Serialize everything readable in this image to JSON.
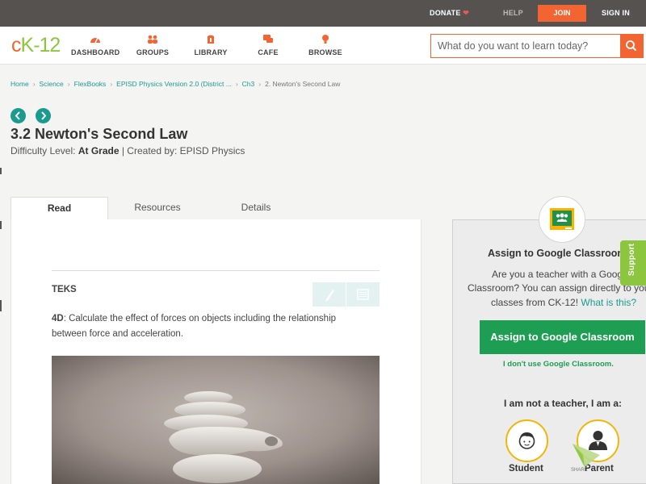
{
  "topbar": {
    "donate": "DONATE",
    "help": "HELP",
    "join": "JOIN",
    "signin": "SIGN IN"
  },
  "header": {
    "logo": {
      "c": "c",
      "k": "K",
      "dash": "-",
      "num": "12"
    },
    "nav": [
      {
        "label": "DASHBOARD",
        "icon": "dashboard-icon"
      },
      {
        "label": "GROUPS",
        "icon": "groups-icon"
      },
      {
        "label": "LIBRARY",
        "icon": "library-icon"
      },
      {
        "label": "CAFE",
        "icon": "cafe-icon"
      },
      {
        "label": "BROWSE",
        "icon": "browse-icon"
      }
    ],
    "search_placeholder": "What do you want to learn today?"
  },
  "breadcrumb": [
    "Home",
    "Science",
    "FlexBooks",
    "EPISD Physics Version 2.0 (District ...",
    "Ch3",
    "2. Newton's Second Law"
  ],
  "page": {
    "title": "3.2 Newton's Second Law",
    "difficulty_prefix": "Difficulty Level:",
    "difficulty": "At Grade",
    "created_by": "| Created by: EPISD Physics"
  },
  "tabs": [
    "Read",
    "Resources",
    "Details"
  ],
  "content": {
    "heading": "TEKS",
    "code": "4D",
    "text_line1": ":  Calculate the effect of forces on objects including the relationship",
    "text_line2": "between force and acceleration."
  },
  "panel": {
    "title": "Assign to Google Classroom",
    "line1": "Are you a teacher with a Google",
    "line2": "Classroom? You can assign directly to your",
    "line3": "classes from CK-12!",
    "link": "What is this?",
    "button": "Assign to Google Classroom",
    "no_google": "I don't use Google Classroom.",
    "not_teacher": "I am not a teacher, I am a:",
    "roles": [
      "Student",
      "Parent"
    ]
  },
  "support": "Support",
  "share": "SHARE",
  "colors": {
    "accent": "#f26532",
    "teal": "#1a9b8e",
    "green": "#1e9e52",
    "lime": "#8cc63f"
  }
}
